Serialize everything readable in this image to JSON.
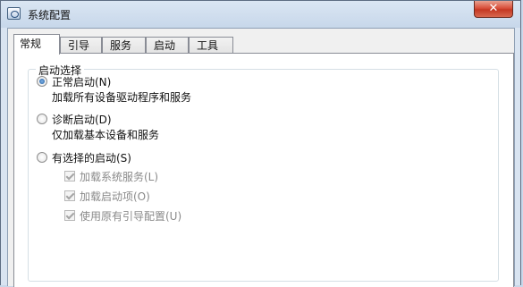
{
  "window": {
    "title": "系统配置",
    "close_glyph": "✕"
  },
  "tabs": [
    {
      "label": "常规",
      "active": true
    },
    {
      "label": "引导",
      "active": false
    },
    {
      "label": "服务",
      "active": false
    },
    {
      "label": "启动",
      "active": false
    },
    {
      "label": "工具",
      "active": false
    }
  ],
  "startup": {
    "group_title": "启动选择",
    "normal": {
      "label": "正常启动(N)",
      "description": "加载所有设备驱动程序和服务",
      "checked": true
    },
    "diagnostic": {
      "label": "诊断启动(D)",
      "description": "仅加载基本设备和服务",
      "checked": false
    },
    "selective": {
      "label": "有选择的启动(S)",
      "checked": false,
      "options": [
        {
          "label": "加载系统服务(L)",
          "checked": true,
          "disabled": true
        },
        {
          "label": "加载启动项(O)",
          "checked": true,
          "disabled": true
        },
        {
          "label": "使用原有引导配置(U)",
          "checked": true,
          "disabled": true
        }
      ]
    }
  }
}
